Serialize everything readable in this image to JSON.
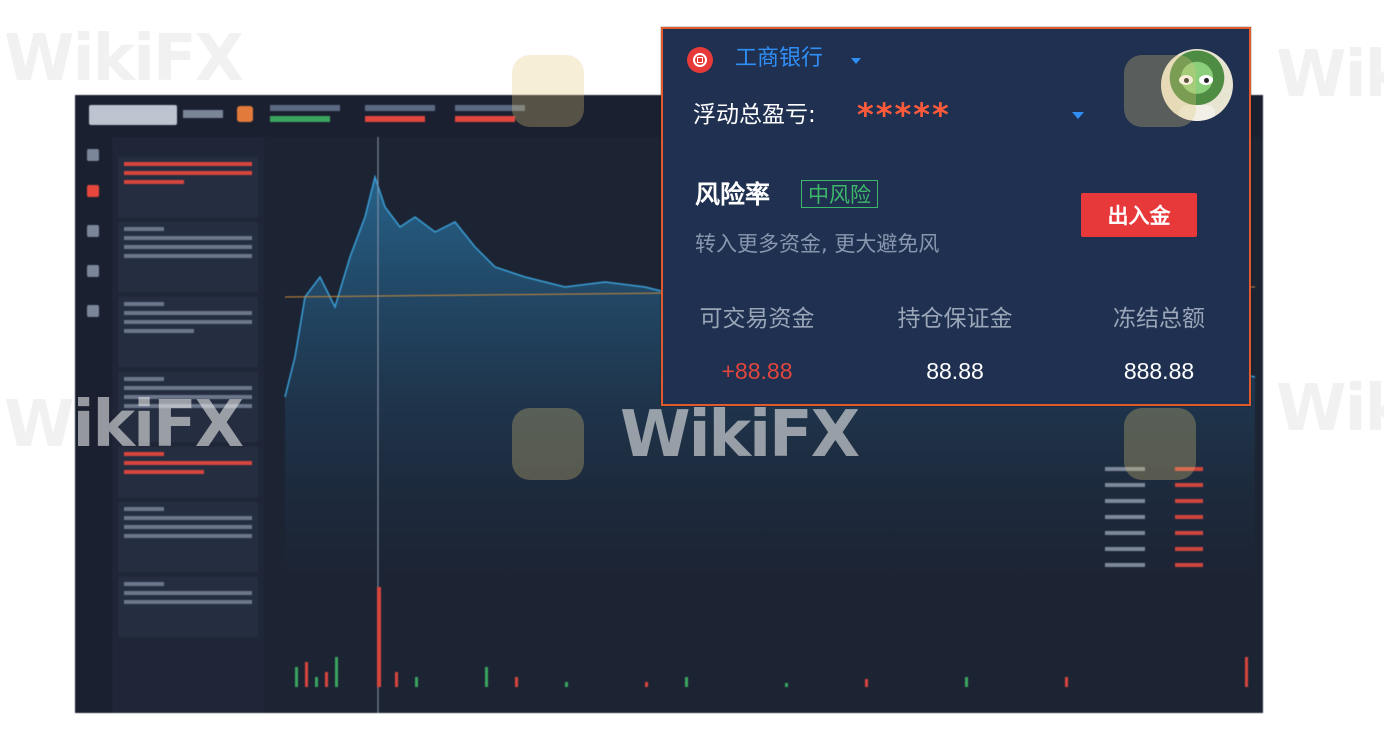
{
  "watermark": {
    "text": "WikiFX"
  },
  "account_card": {
    "bank_name": "工商银行",
    "floating_pnl_label": "浮动总盈亏:",
    "floating_pnl_value": "*****",
    "risk_label": "风险率",
    "risk_level": "中风险",
    "risk_tip": "转入更多资金, 更大避免风",
    "funds_button": "出入金",
    "stats": [
      {
        "label": "可交易资金",
        "value": "+88.88",
        "color": "#e0463e"
      },
      {
        "label": "持仓保证金",
        "value": "88.88",
        "color": "#ffffff"
      },
      {
        "label": "冻结总额",
        "value": "888.88",
        "color": "#ffffff"
      }
    ]
  },
  "colors": {
    "card_bg": "#1f3050",
    "card_border": "#e05a2b",
    "accent_blue": "#2f8ff7",
    "danger_red": "#e8393a",
    "risk_green": "#3db86a"
  },
  "icons": [
    "bank-logo-icon",
    "caret-down-icon",
    "avatar-image"
  ]
}
